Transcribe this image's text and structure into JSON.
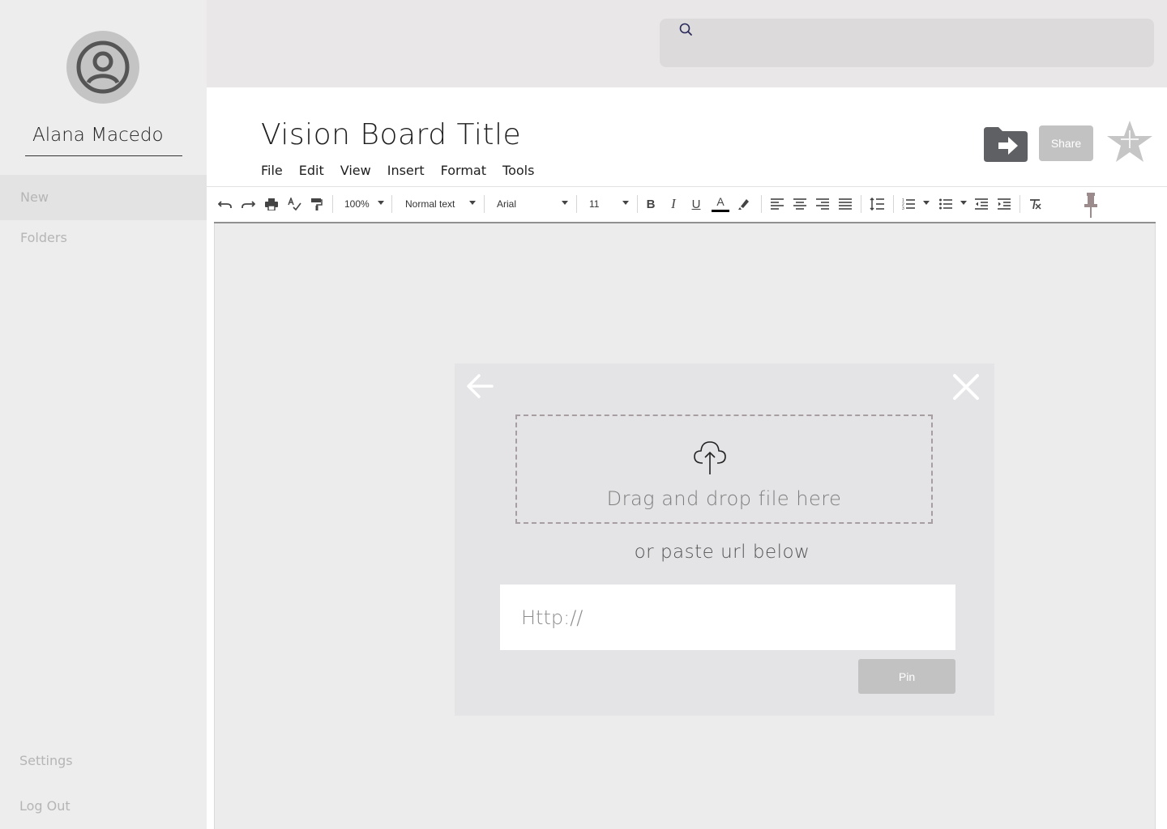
{
  "user": {
    "name": "Alana Macedo"
  },
  "sidebar": {
    "items": [
      {
        "label": "New"
      },
      {
        "label": "Folders"
      }
    ],
    "bottom": [
      {
        "label": "Settings"
      },
      {
        "label": "Log Out"
      }
    ]
  },
  "search": {
    "placeholder": "",
    "icon": "search-icon"
  },
  "document": {
    "title": "Vision Board Title",
    "menu": [
      "File",
      "Edit",
      "View",
      "Insert",
      "Format",
      "Tools"
    ],
    "share_label": "Share"
  },
  "toolbar": {
    "zoom": "100%",
    "style": "Normal text",
    "font": "Arial",
    "size": "11"
  },
  "modal": {
    "drop_text": "Drag and drop file here",
    "or_text": "or paste url below",
    "url_placeholder": "Http://",
    "pin_label": "Pin"
  },
  "colors": {
    "sidebar_bg": "#ededed",
    "topbar_bg": "#e9e7e8",
    "canvas_bg": "#ececec",
    "modal_bg": "#e4e3e5",
    "button_gray": "#c2c2c2",
    "dashed_border": "#a69ea1"
  }
}
